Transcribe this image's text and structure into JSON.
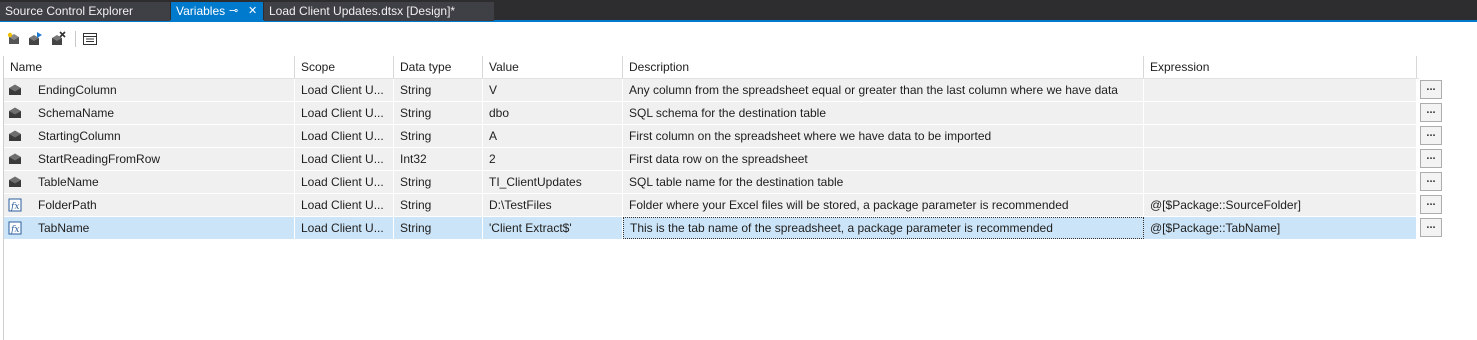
{
  "tabs": [
    {
      "label": "Source Control Explorer",
      "active": false
    },
    {
      "label": "Variables",
      "active": true
    },
    {
      "label": "Load Client Updates.dtsx [Design]*",
      "active": false
    }
  ],
  "tab_icons": {
    "pin": "⊸",
    "close": "✕"
  },
  "toolbar": {
    "buttons": [
      "add-variable-icon",
      "move-variable-icon",
      "delete-variable-icon",
      "grid-options-icon"
    ]
  },
  "columns": [
    "Name",
    "Scope",
    "Data type",
    "Value",
    "Description",
    "Expression"
  ],
  "rows": [
    {
      "icon": "variable-icon",
      "name": "EndingColumn",
      "scope": "Load Client U...",
      "type": "String",
      "value": "V",
      "description": "Any column from the spreadsheet equal or greater than the last column where we have data",
      "expression": ""
    },
    {
      "icon": "variable-icon",
      "name": "SchemaName",
      "scope": "Load Client U...",
      "type": "String",
      "value": "dbo",
      "description": "SQL schema for the destination table",
      "expression": ""
    },
    {
      "icon": "variable-icon",
      "name": "StartingColumn",
      "scope": "Load Client U...",
      "type": "String",
      "value": "A",
      "description": "First column on the spreadsheet where we have data to be imported",
      "expression": ""
    },
    {
      "icon": "variable-icon",
      "name": "StartReadingFromRow",
      "scope": "Load Client U...",
      "type": "Int32",
      "value": "2",
      "description": "First data row on the spreadsheet",
      "expression": ""
    },
    {
      "icon": "variable-icon",
      "name": "TableName",
      "scope": "Load Client U...",
      "type": "String",
      "value": "TI_ClientUpdates",
      "description": "SQL table name for the destination table",
      "expression": ""
    },
    {
      "icon": "expression-variable-icon",
      "name": "FolderPath",
      "scope": "Load Client U...",
      "type": "String",
      "value": "D:\\TestFiles",
      "description": "Folder where your Excel files will be stored, a package parameter is recommended",
      "expression": "@[$Package::SourceFolder]"
    },
    {
      "icon": "expression-variable-icon",
      "name": "TabName",
      "scope": "Load Client U...",
      "type": "String",
      "value": "'Client Extract$'",
      "description": "This is the tab name of the spreadsheet, a package parameter is recommended",
      "expression": "@[$Package::TabName]",
      "selected": true
    }
  ],
  "ellipsis_label": "...",
  "colors": {
    "accent": "#007acc",
    "selected_row": "#cce4f7",
    "row_bg": "#f0f0f0"
  }
}
